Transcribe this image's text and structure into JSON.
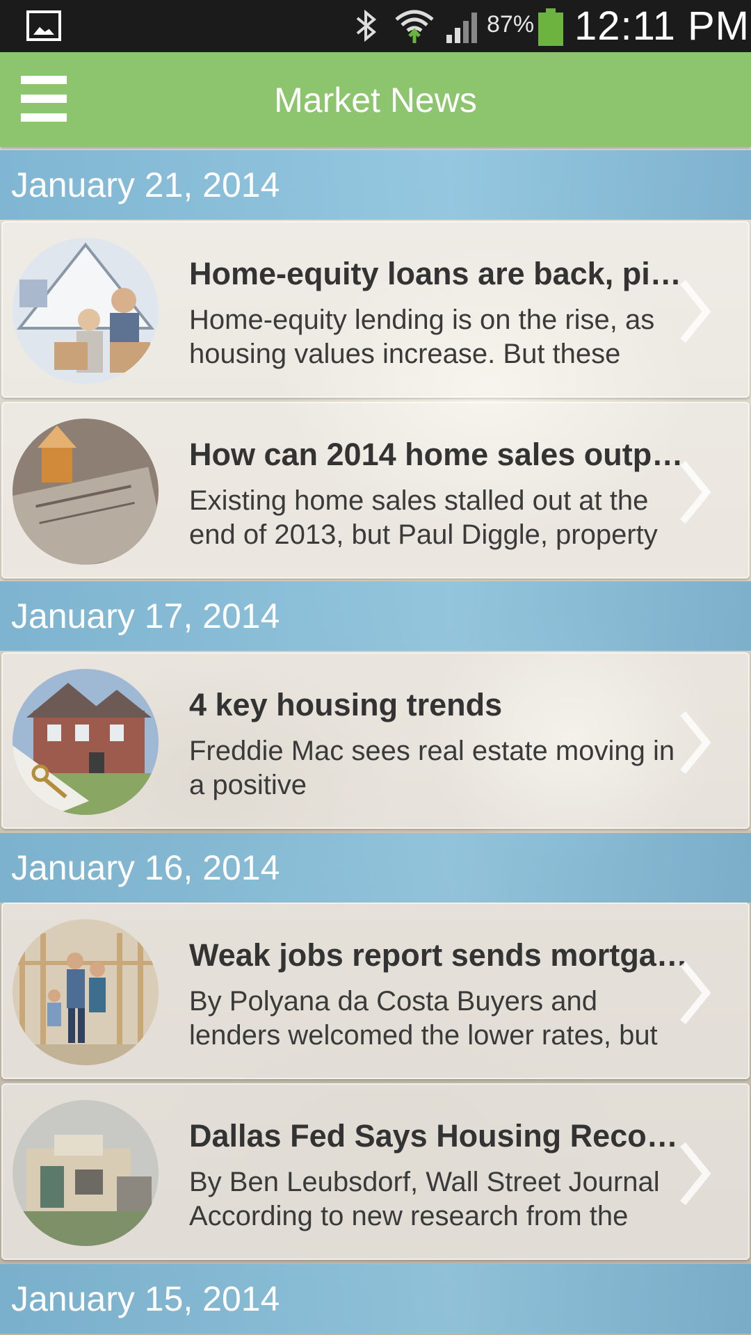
{
  "status_bar": {
    "battery_percent": "87%",
    "time": "12:11 PM",
    "icons": [
      "gallery-notification-icon",
      "bluetooth-icon",
      "wifi-icon",
      "signal-icon",
      "battery-icon"
    ]
  },
  "app_bar": {
    "title": "Market News",
    "menu_icon": "hamburger-menu-icon",
    "color": "#8dc56e"
  },
  "sections": [
    {
      "date": "January 21, 2014",
      "items": [
        {
          "title": "Home-equity loans are back, pi…",
          "summary": "Home-equity lending is on the rise, as housing values increase. But these"
        },
        {
          "title": "How can 2014 home sales outp…",
          "summary": "Existing home sales stalled out at the end of 2013, but Paul Diggle, property"
        }
      ]
    },
    {
      "date": "January 17, 2014",
      "items": [
        {
          "title": "4 key housing trends",
          "summary": "Freddie Mac sees real estate moving in a positive"
        }
      ]
    },
    {
      "date": "January 16, 2014",
      "items": [
        {
          "title": "Weak jobs report sends mortga…",
          "summary": "By Polyana da Costa Buyers and lenders welcomed the lower rates, but"
        },
        {
          "title": "Dallas Fed Says Housing Recov…",
          "summary": "By Ben Leubsdorf, Wall Street Journal According to new research from the"
        }
      ]
    },
    {
      "date": "January 15, 2014",
      "items": []
    }
  ],
  "colors": {
    "date_header": "#7fbadb",
    "title_text": "#333333",
    "battery": "#6cb33f"
  }
}
